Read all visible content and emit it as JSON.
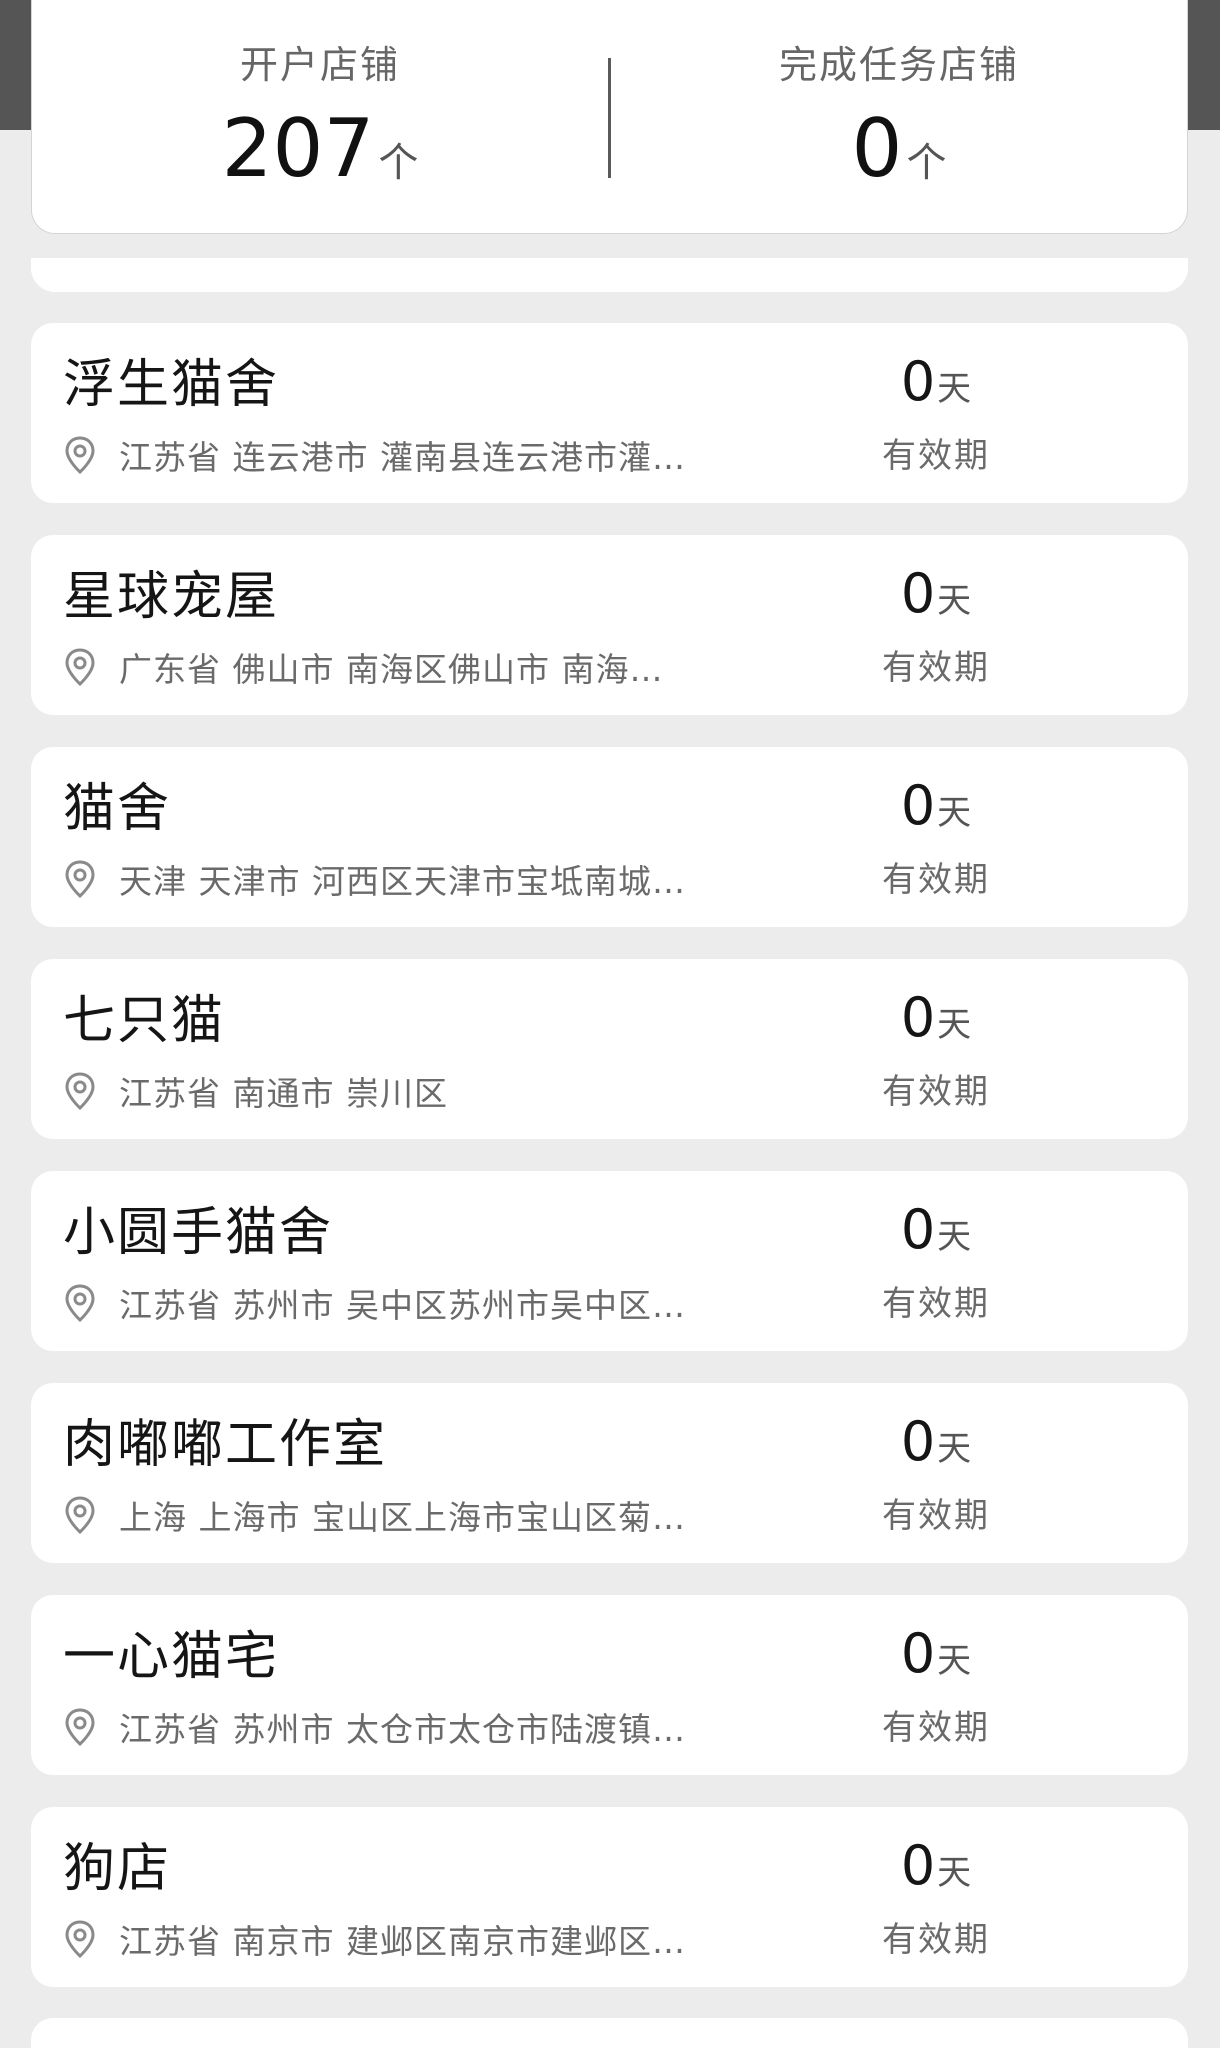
{
  "stats": {
    "opened_label": "开户店铺",
    "opened_value": "207",
    "opened_unit": "个",
    "completed_label": "完成任务店铺",
    "completed_value": "0",
    "completed_unit": "个"
  },
  "icons": {
    "location": "location-pin-icon"
  },
  "colors": {
    "top_bar": "#555555",
    "page_background": "#ececec",
    "card_background": "#ffffff"
  },
  "stores": [
    {
      "name": "浮生猫舍",
      "address": "江苏省 连云港市 灌南县连云港市灌…",
      "validity_value": "0",
      "validity_unit": "天",
      "validity_label": "有效期"
    },
    {
      "name": "星球宠屋",
      "address": "广东省 佛山市 南海区佛山市 南海…",
      "validity_value": "0",
      "validity_unit": "天",
      "validity_label": "有效期"
    },
    {
      "name": "猫舍",
      "address": "天津 天津市 河西区天津市宝坻南城…",
      "validity_value": "0",
      "validity_unit": "天",
      "validity_label": "有效期"
    },
    {
      "name": "七只猫",
      "address": "江苏省 南通市 崇川区",
      "validity_value": "0",
      "validity_unit": "天",
      "validity_label": "有效期"
    },
    {
      "name": "小圆手猫舍",
      "address": "江苏省 苏州市 吴中区苏州市吴中区…",
      "validity_value": "0",
      "validity_unit": "天",
      "validity_label": "有效期"
    },
    {
      "name": "肉嘟嘟工作室",
      "address": "上海 上海市 宝山区上海市宝山区菊…",
      "validity_value": "0",
      "validity_unit": "天",
      "validity_label": "有效期"
    },
    {
      "name": "一心猫宅",
      "address": "江苏省 苏州市 太仓市太仓市陆渡镇…",
      "validity_value": "0",
      "validity_unit": "天",
      "validity_label": "有效期"
    },
    {
      "name": "狗店",
      "address": "江苏省 南京市 建邺区南京市建邺区…",
      "validity_value": "0",
      "validity_unit": "天",
      "validity_label": "有效期"
    }
  ]
}
